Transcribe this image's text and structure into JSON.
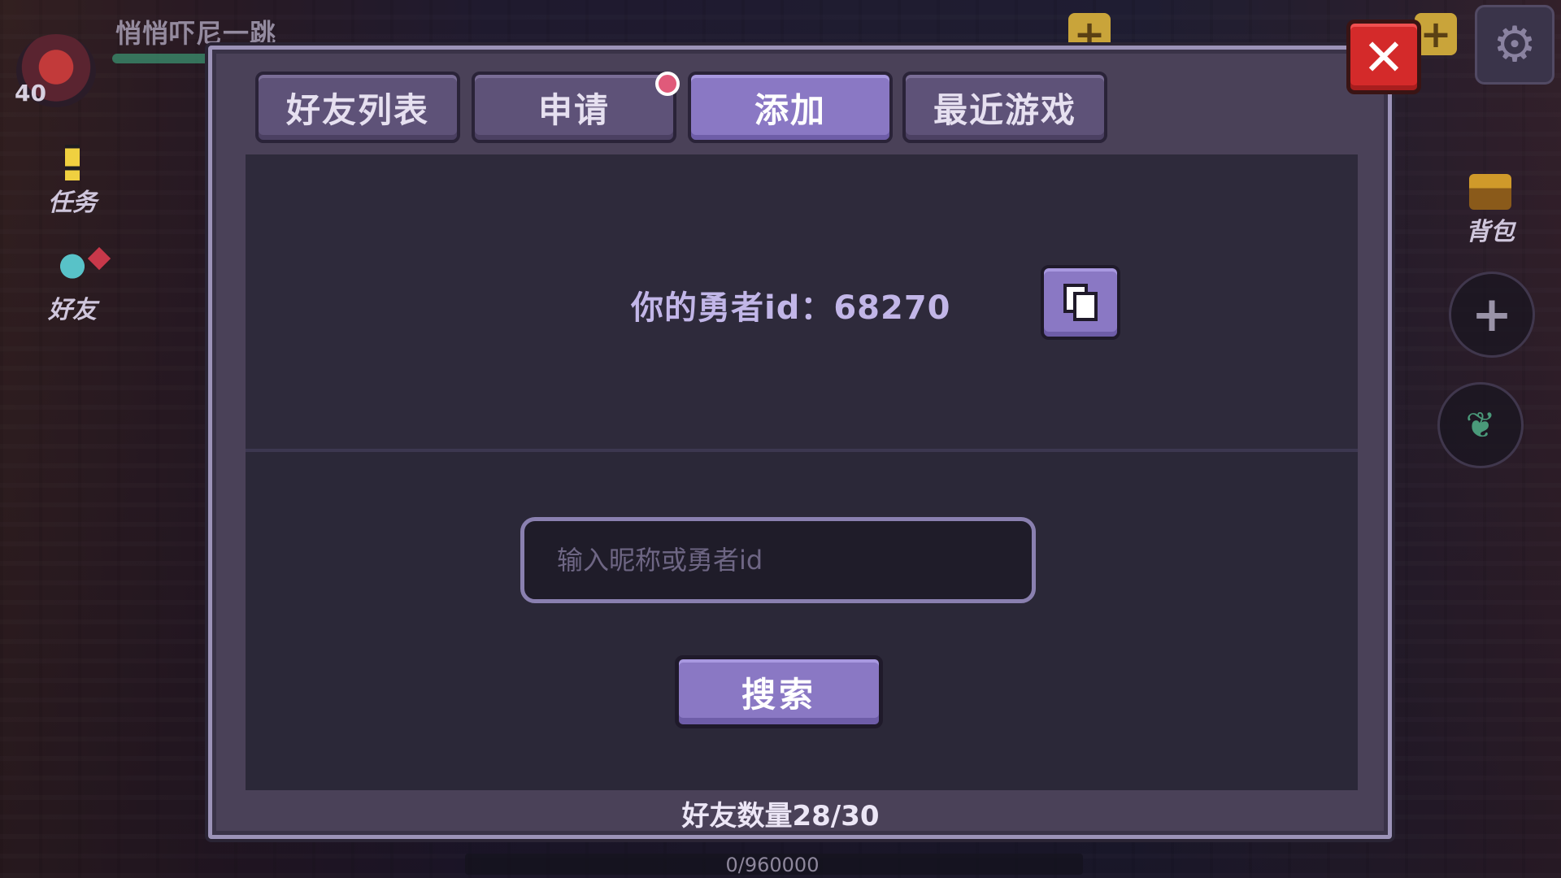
{
  "hud": {
    "player_name": "悄悄吓尼一跳",
    "level": "40",
    "quest_label": "任务",
    "friend_label": "好友",
    "bag_label": "背包",
    "exp_text": "0/960000"
  },
  "tabs": [
    {
      "label": "好友列表",
      "active": false
    },
    {
      "label": "申请",
      "active": false,
      "has_notification": true
    },
    {
      "label": "添加",
      "active": true
    },
    {
      "label": "最近游戏",
      "active": false
    }
  ],
  "add_panel": {
    "hero_id_text": "你的勇者id：68270",
    "search_placeholder": "输入昵称或勇者id",
    "search_value": "",
    "search_button": "搜索"
  },
  "footer": {
    "friend_count": "好友数量28/30"
  },
  "colors": {
    "accent": "#8a78c4",
    "close": "#d42a2a",
    "panel": "#2b2838",
    "dialog": "#4a4158"
  }
}
